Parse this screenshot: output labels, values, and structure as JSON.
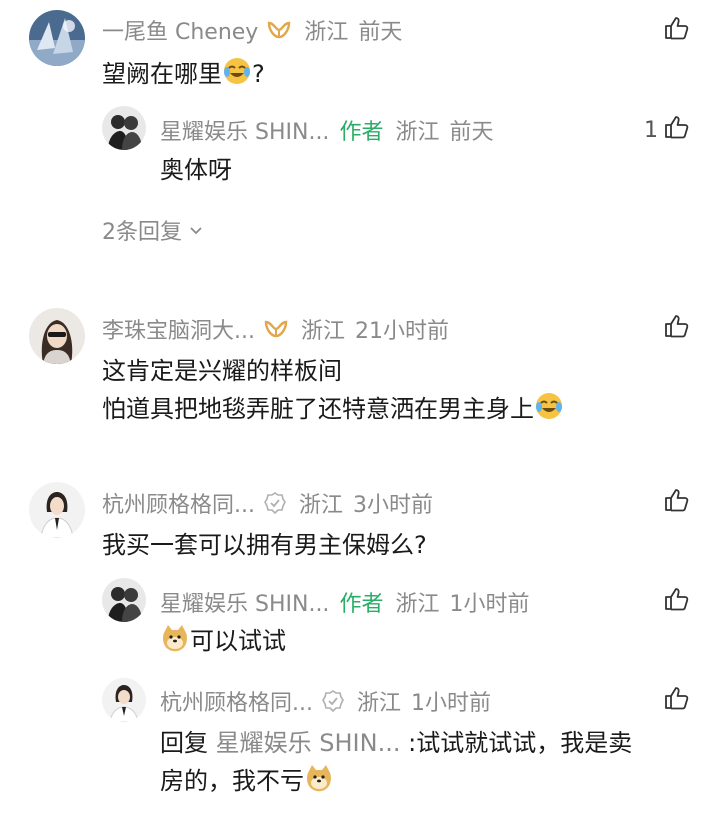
{
  "comments": [
    {
      "name": "一尾鱼 Cheney",
      "location": "浙江",
      "time": "前天",
      "text": "望阙在哪里",
      "text_suffix": "?",
      "replies": [
        {
          "name": "星耀娱乐 SHIN...",
          "author_label": "作者",
          "location": "浙江",
          "time": "前天",
          "text": "奥体呀",
          "likes": "1"
        }
      ],
      "expand_label": "2条回复"
    },
    {
      "name": "李珠宝脑洞大...",
      "location": "浙江",
      "time": "21小时前",
      "text_line1": "这肯定是兴耀的样板间",
      "text_line2": "怕道具把地毯弄脏了还特意洒在男主身上"
    },
    {
      "name": "杭州顾格格同...",
      "location": "浙江",
      "time": "3小时前",
      "text": "我买一套可以拥有男主保姆么?",
      "replies": [
        {
          "name": "星耀娱乐 SHIN...",
          "author_label": "作者",
          "location": "浙江",
          "time": "1小时前",
          "text": "可以试试"
        },
        {
          "name": "杭州顾格格同...",
          "location": "浙江",
          "time": "1小时前",
          "reply_prefix": "回复",
          "reply_target": "星耀娱乐 SHIN...",
          "text_line1": ":试试就试试，我是卖",
          "text_line2": "房的，我不亏"
        }
      ]
    }
  ],
  "colors": {
    "author": "#2aae67",
    "meta": "#8a8a8a",
    "text": "#1a1a1a",
    "badge": "#e3a64a"
  },
  "icons": {
    "like": "thumbs-up-icon",
    "verified": "verified-badge-icon",
    "vip": "vip-badge-icon",
    "chevron": "chevron-down-icon"
  }
}
